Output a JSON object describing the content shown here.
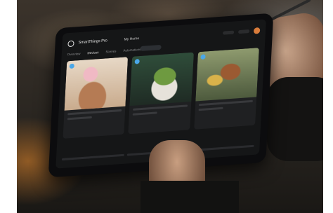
{
  "app": {
    "brand": "SmartThings Pro",
    "home_label": "My Home"
  },
  "tabs": [
    {
      "label": "Overview"
    },
    {
      "label": "Devices"
    },
    {
      "label": "Scenes"
    },
    {
      "label": "Automations"
    }
  ],
  "colors": {
    "accent": "#4aa7e8",
    "avatar": "#d97c3b",
    "screen_bg": "#151617"
  },
  "icons": {
    "logo": "smartthings-logo-icon",
    "profile": "avatar-icon"
  }
}
